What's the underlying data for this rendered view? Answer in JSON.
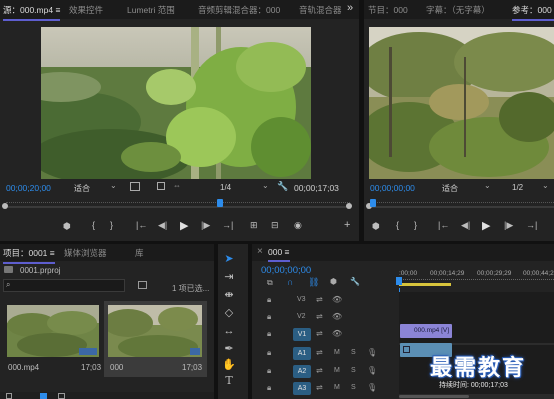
{
  "source_panel": {
    "tabs": [
      "源：000.mp4 ≡",
      "效果控件",
      "Lumetri 范围",
      "音频剪辑混合器：000",
      "音轨混合器"
    ],
    "overflow_glyph": "»",
    "timecode": "00;00;20;00",
    "fit_label": "适合",
    "fit_chevron": "⌄",
    "zoom_label": "1/4",
    "duration": "00;00;17;03"
  },
  "program_panel": {
    "tabs": [
      "节目：000",
      "字幕：（无字幕）",
      "参考：000 ≡"
    ],
    "timecode": "00;00;00;00",
    "fit_label": "适合",
    "fit_chevron": "⌄",
    "zoom_label": "1/2"
  },
  "project_panel": {
    "tabs": [
      "项目：0001 ≡",
      "媒体浏览器",
      "库"
    ],
    "project_file": "0001.prproj",
    "selection_status": "1 项已选...",
    "items": [
      {
        "name": "000.mp4",
        "duration": "17;03"
      },
      {
        "name": "000",
        "duration": "17;03"
      }
    ]
  },
  "timeline_panel": {
    "close_glyph": "×",
    "tab_label": "000 ≡",
    "timecode": "00;00;00;00",
    "ruler_labels": [
      ":00;00",
      "00;00;14;29",
      "00;00;29;29",
      "00;00;44;2"
    ],
    "tracks": [
      {
        "label": "V3",
        "type": "video"
      },
      {
        "label": "V2",
        "type": "video"
      },
      {
        "label": "V1",
        "type": "video"
      },
      {
        "label": "A1",
        "type": "audio"
      },
      {
        "label": "A2",
        "type": "audio"
      },
      {
        "label": "A3",
        "type": "audio"
      }
    ],
    "mute_label": "M",
    "solo_label": "S",
    "video_clip_label": "000.mp4 [V]",
    "tooltip": "持续时间: 00;00;17;03"
  },
  "watermark": "最需教育",
  "colors": {
    "accent_blue": "#2d8ceb",
    "video_clip": "#8b84d6",
    "audio_clip": "#5b8fb4",
    "track_selected": "#2b5e83",
    "playhead": "#2d8ceb"
  }
}
